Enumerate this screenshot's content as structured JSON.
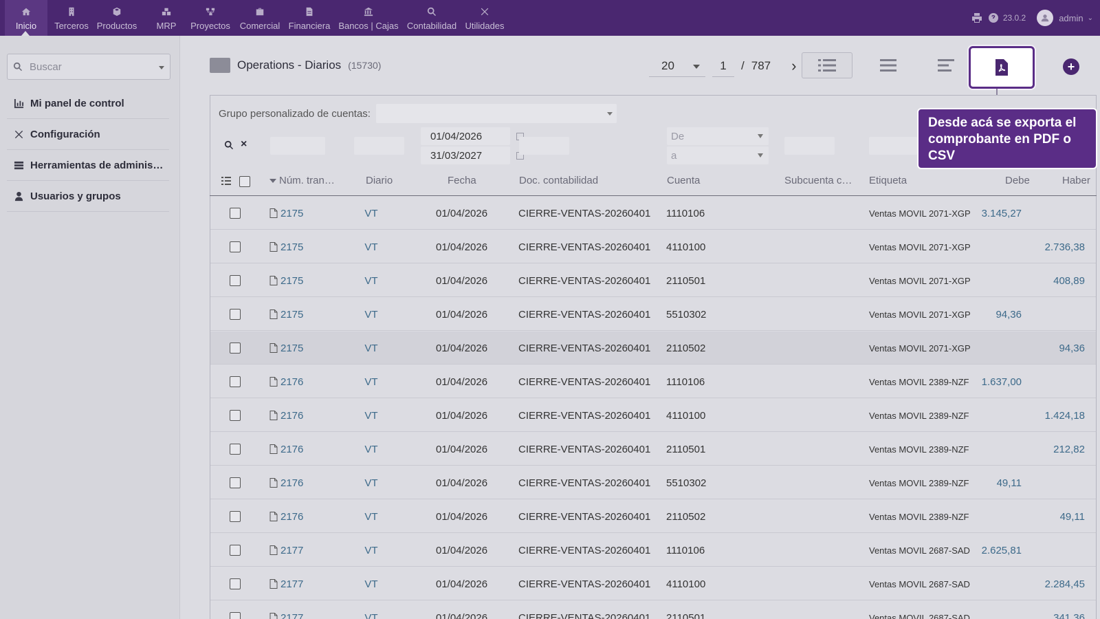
{
  "topnav": {
    "items": [
      {
        "label": "Inicio",
        "icon": "home-icon"
      },
      {
        "label": "Terceros",
        "icon": "building-icon"
      },
      {
        "label": "Productos",
        "icon": "cube-icon"
      },
      {
        "label": "MRP",
        "icon": "cubes-icon"
      },
      {
        "label": "Proyectos",
        "icon": "project-diagram-icon"
      },
      {
        "label": "Comercial",
        "icon": "briefcase-icon"
      },
      {
        "label": "Financiera",
        "icon": "file-invoice-icon"
      },
      {
        "label": "Bancos | Cajas",
        "icon": "bank-icon"
      },
      {
        "label": "Contabilidad",
        "icon": "search-dollar-icon"
      },
      {
        "label": "Utilidades",
        "icon": "tools-icon"
      }
    ],
    "version": "23.0.2",
    "user": "admin"
  },
  "sidebar": {
    "search_placeholder": "Buscar",
    "items": [
      {
        "label": "Mi panel de control",
        "icon": "chart-icon"
      },
      {
        "label": "Configuración",
        "icon": "tools-icon"
      },
      {
        "label": "Herramientas de administración",
        "icon": "server-icon"
      },
      {
        "label": "Usuarios y grupos",
        "icon": "user-icon"
      }
    ]
  },
  "page": {
    "title": "Operations - Diarios",
    "count": "(15730)"
  },
  "pager": {
    "limit": "20",
    "page": "1",
    "separator": "/",
    "total_pages": "787"
  },
  "filters": {
    "group_label": "Grupo personalizado de cuentas:",
    "date_from": "01/04/2026",
    "date_to": "31/03/2027",
    "account_from_placeholder": "De",
    "account_to_placeholder": "a"
  },
  "table": {
    "headers": {
      "num": "Núm. tran…",
      "diario": "Diario",
      "fecha": "Fecha",
      "doc": "Doc. contabilidad",
      "cuenta": "Cuenta",
      "subcuenta": "Subcuenta c…",
      "etiqueta": "Etiqueta",
      "debe": "Debe",
      "haber": "Haber"
    },
    "rows": [
      {
        "num": "2175",
        "diario": "VT",
        "fecha": "01/04/2026",
        "doc": "CIERRE-VENTAS-20260401",
        "cuenta": "1110106",
        "etiqueta": "Ventas MOVIL 2071-XGP",
        "debe": "3.145,27",
        "haber": ""
      },
      {
        "num": "2175",
        "diario": "VT",
        "fecha": "01/04/2026",
        "doc": "CIERRE-VENTAS-20260401",
        "cuenta": "4110100",
        "etiqueta": "Ventas MOVIL 2071-XGP",
        "debe": "",
        "haber": "2.736,38"
      },
      {
        "num": "2175",
        "diario": "VT",
        "fecha": "01/04/2026",
        "doc": "CIERRE-VENTAS-20260401",
        "cuenta": "2110501",
        "etiqueta": "Ventas MOVIL 2071-XGP",
        "debe": "",
        "haber": "408,89"
      },
      {
        "num": "2175",
        "diario": "VT",
        "fecha": "01/04/2026",
        "doc": "CIERRE-VENTAS-20260401",
        "cuenta": "5510302",
        "etiqueta": "Ventas MOVIL 2071-XGP",
        "debe": "94,36",
        "haber": ""
      },
      {
        "num": "2175",
        "diario": "VT",
        "fecha": "01/04/2026",
        "doc": "CIERRE-VENTAS-20260401",
        "cuenta": "2110502",
        "etiqueta": "Ventas MOVIL 2071-XGP",
        "debe": "",
        "haber": "94,36"
      },
      {
        "num": "2176",
        "diario": "VT",
        "fecha": "01/04/2026",
        "doc": "CIERRE-VENTAS-20260401",
        "cuenta": "1110106",
        "etiqueta": "Ventas MOVIL 2389-NZF",
        "debe": "1.637,00",
        "haber": ""
      },
      {
        "num": "2176",
        "diario": "VT",
        "fecha": "01/04/2026",
        "doc": "CIERRE-VENTAS-20260401",
        "cuenta": "4110100",
        "etiqueta": "Ventas MOVIL 2389-NZF",
        "debe": "",
        "haber": "1.424,18"
      },
      {
        "num": "2176",
        "diario": "VT",
        "fecha": "01/04/2026",
        "doc": "CIERRE-VENTAS-20260401",
        "cuenta": "2110501",
        "etiqueta": "Ventas MOVIL 2389-NZF",
        "debe": "",
        "haber": "212,82"
      },
      {
        "num": "2176",
        "diario": "VT",
        "fecha": "01/04/2026",
        "doc": "CIERRE-VENTAS-20260401",
        "cuenta": "5510302",
        "etiqueta": "Ventas MOVIL 2389-NZF",
        "debe": "49,11",
        "haber": ""
      },
      {
        "num": "2176",
        "diario": "VT",
        "fecha": "01/04/2026",
        "doc": "CIERRE-VENTAS-20260401",
        "cuenta": "2110502",
        "etiqueta": "Ventas MOVIL 2389-NZF",
        "debe": "",
        "haber": "49,11"
      },
      {
        "num": "2177",
        "diario": "VT",
        "fecha": "01/04/2026",
        "doc": "CIERRE-VENTAS-20260401",
        "cuenta": "1110106",
        "etiqueta": "Ventas MOVIL 2687-SAD",
        "debe": "2.625,81",
        "haber": ""
      },
      {
        "num": "2177",
        "diario": "VT",
        "fecha": "01/04/2026",
        "doc": "CIERRE-VENTAS-20260401",
        "cuenta": "4110100",
        "etiqueta": "Ventas MOVIL 2687-SAD",
        "debe": "",
        "haber": "2.284,45"
      },
      {
        "num": "2177",
        "diario": "VT",
        "fecha": "01/04/2026",
        "doc": "CIERRE-VENTAS-20260401",
        "cuenta": "2110501",
        "etiqueta": "Ventas MOVIL 2687-SAD",
        "debe": "",
        "haber": "341,36"
      }
    ]
  },
  "tooltip": {
    "text": "Desde acá se exporta el comprobante en PDF o CSV"
  },
  "colors": {
    "topbar": "#4a2770",
    "accent": "#5a2d86",
    "link": "#3d6a8a"
  }
}
